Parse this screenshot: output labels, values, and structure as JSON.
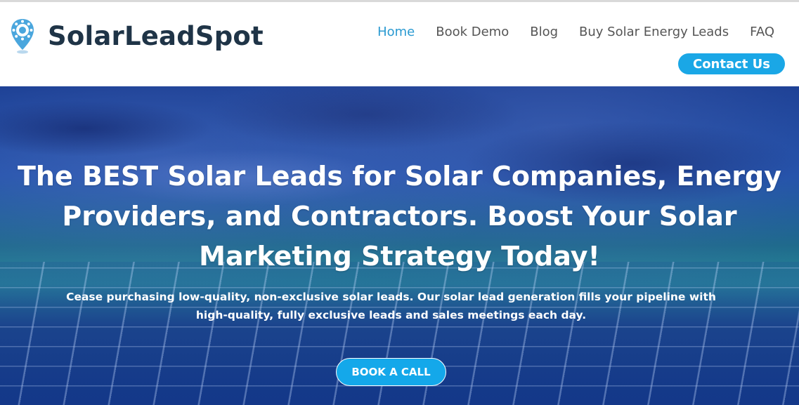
{
  "brand": {
    "name": "SolarLeadSpot",
    "icon": "map-pin-sun-icon",
    "color": "#1f3447",
    "accent": "#2a9ad1"
  },
  "nav": {
    "items": [
      {
        "label": "Home",
        "active": true
      },
      {
        "label": "Book Demo",
        "active": false
      },
      {
        "label": "Blog",
        "active": false
      },
      {
        "label": "Buy Solar Energy Leads",
        "active": false
      },
      {
        "label": "FAQ",
        "active": false
      }
    ],
    "contact_label": "Contact Us"
  },
  "hero": {
    "title_lines": [
      "The BEST Solar Leads for Solar Companies, Energy",
      "Providers, and Contractors. Boost Your Solar",
      "Marketing Strategy Today!"
    ],
    "subtitle_lines": [
      "Cease purchasing low-quality, non-exclusive solar leads. Our solar lead generation fills your pipeline with",
      "high-quality, fully exclusive leads and sales meetings each day."
    ],
    "cta_label": "BOOK A CALL",
    "button_color": "#14a8ea"
  }
}
